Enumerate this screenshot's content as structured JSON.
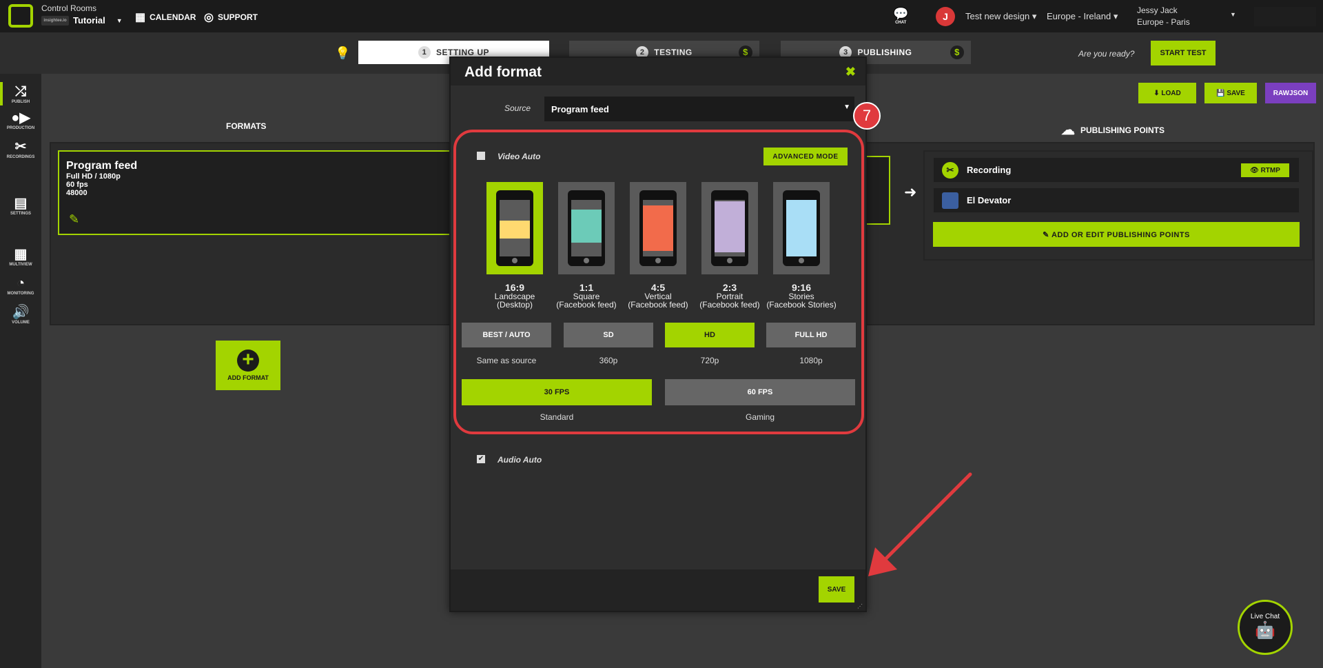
{
  "header": {
    "app": "Control Rooms",
    "room_chip": "insightee.io",
    "room": "Tutorial",
    "calendar": "CALENDAR",
    "support": "SUPPORT",
    "chat": "CHAT",
    "user_initial": "J",
    "project": "Test new design",
    "region": "Europe - Ireland",
    "user_name": "Jessy Jack",
    "user_zone": "Europe - Paris"
  },
  "steps": [
    {
      "n": "1",
      "label": "SETTING UP"
    },
    {
      "n": "2",
      "label": "TESTING"
    },
    {
      "n": "3",
      "label": "PUBLISHING"
    }
  ],
  "ready": "Are you ready?",
  "start_test": "START TEST",
  "toolbar": {
    "load": "LOAD",
    "save": "SAVE",
    "rawjson": "RAWJSON"
  },
  "sidebar": [
    "PUBLISH",
    "PRODUCTION",
    "RECORDINGS",
    "SETTINGS",
    "MULTIVIEW",
    "MONITORING",
    "VOLUME"
  ],
  "formats": {
    "title": "FORMATS",
    "card_title": "Program feed",
    "lines": [
      "Full HD / 1080p",
      "60 fps",
      "48000"
    ],
    "add": "ADD FORMAT"
  },
  "publishing": {
    "title": "PUBLISHING POINTS",
    "items": [
      "Recording",
      "El Devator"
    ],
    "rtmp": "RTMP",
    "add_edit": "ADD OR EDIT PUBLISHING POINTS"
  },
  "modal": {
    "title": "Add format",
    "close": "✖",
    "source_label": "Source",
    "source_value": "Program feed",
    "badge": "7",
    "video_auto": "Video Auto",
    "advanced": "ADVANCED MODE",
    "aspects": [
      {
        "ratio": "16:9",
        "l1": "Landscape",
        "l2": "(Desktop)",
        "color": "#ffd970",
        "selected": true
      },
      {
        "ratio": "1:1",
        "l1": "Square",
        "l2": "(Facebook feed)",
        "color": "#6ccbb8",
        "selected": false
      },
      {
        "ratio": "4:5",
        "l1": "Vertical",
        "l2": "(Facebook feed)",
        "color": "#f26b4b",
        "selected": false
      },
      {
        "ratio": "2:3",
        "l1": "Portrait",
        "l2": "(Facebook feed)",
        "color": "#c1afd8",
        "selected": false
      },
      {
        "ratio": "9:16",
        "l1": "Stories",
        "l2": "(Facebook Stories)",
        "color": "#a9def6",
        "selected": false
      }
    ],
    "qualities": [
      {
        "label": "BEST / AUTO",
        "cap": "Same as source",
        "selected": false
      },
      {
        "label": "SD",
        "cap": "360p",
        "selected": false
      },
      {
        "label": "HD",
        "cap": "720p",
        "selected": true
      },
      {
        "label": "FULL HD",
        "cap": "1080p",
        "selected": false
      }
    ],
    "fps": [
      {
        "label": "30 FPS",
        "cap": "Standard",
        "selected": true
      },
      {
        "label": "60 FPS",
        "cap": "Gaming",
        "selected": false
      }
    ],
    "audio_auto": "Audio Auto",
    "save": "SAVE"
  },
  "livechat": "Live Chat",
  "colors": {
    "accent": "#a3d400",
    "annotation": "#e03a3e"
  }
}
